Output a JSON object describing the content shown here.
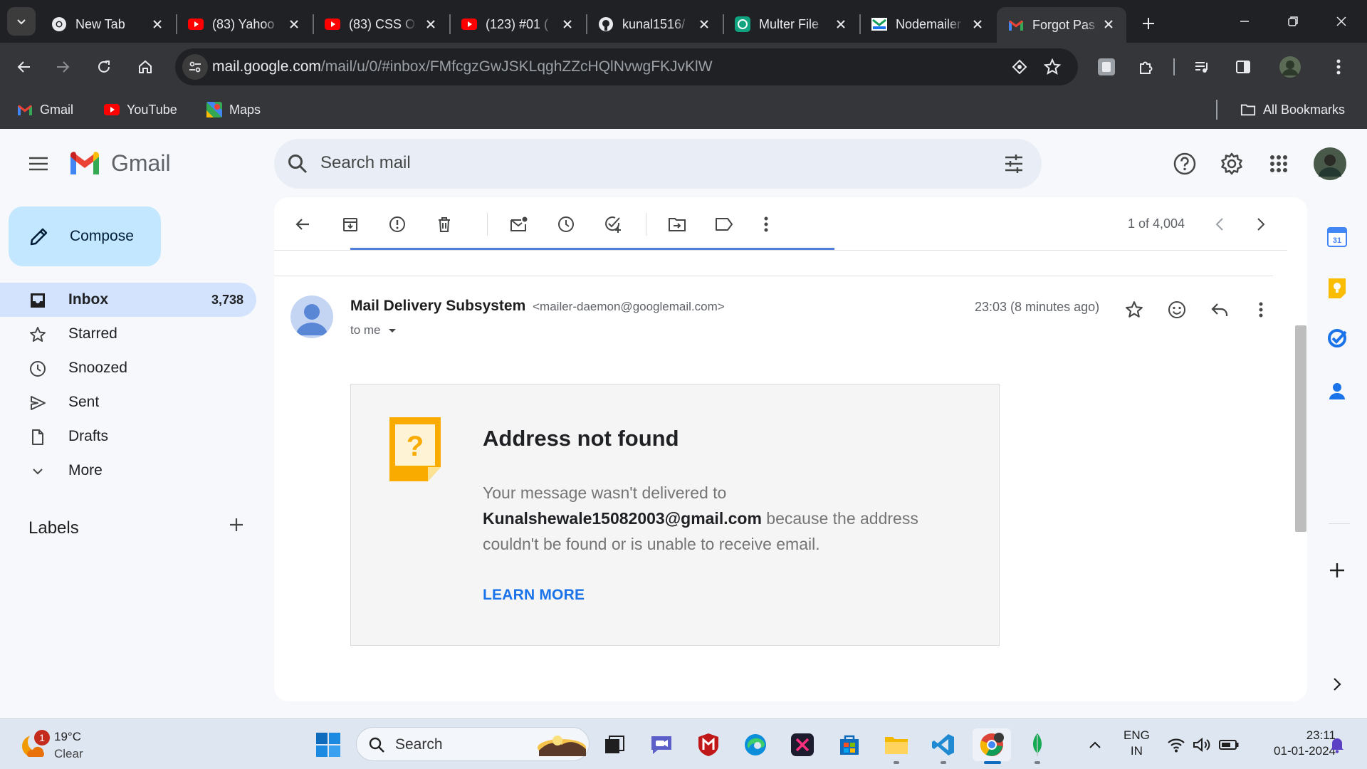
{
  "browser": {
    "tabs": [
      {
        "title": "New Tab",
        "icon": "chrome-icon",
        "active": false
      },
      {
        "title": "(83) Yahoo",
        "icon": "youtube-icon",
        "active": false
      },
      {
        "title": "(83) CSS O",
        "icon": "youtube-icon",
        "active": false
      },
      {
        "title": "(123) #01 (",
        "icon": "youtube-icon",
        "active": false
      },
      {
        "title": "kunal1516/",
        "icon": "github-icon",
        "active": false
      },
      {
        "title": "Multer File",
        "icon": "chatgpt-icon",
        "active": false
      },
      {
        "title": "Nodemailer",
        "icon": "nodemailer-icon",
        "active": false
      },
      {
        "title": "Forgot Pas",
        "icon": "gmail-icon",
        "active": true
      }
    ],
    "url_host": "mail.google.com",
    "url_path": "/mail/u/0/#inbox/FMfcgzGwJSKLqghZZcHQlNvwgFKJvKlW",
    "bookmarks": [
      {
        "label": "Gmail",
        "icon": "gmail-icon"
      },
      {
        "label": "YouTube",
        "icon": "youtube-icon"
      },
      {
        "label": "Maps",
        "icon": "maps-icon"
      }
    ],
    "all_bookmarks": "All Bookmarks"
  },
  "gmail": {
    "brand": "Gmail",
    "search_placeholder": "Search mail",
    "compose_label": "Compose",
    "nav": [
      {
        "label": "Inbox",
        "count": "3,738",
        "icon": "inbox-icon",
        "active": true
      },
      {
        "label": "Starred",
        "count": "",
        "icon": "star-icon",
        "active": false
      },
      {
        "label": "Snoozed",
        "count": "",
        "icon": "clock-icon",
        "active": false
      },
      {
        "label": "Sent",
        "count": "",
        "icon": "send-icon",
        "active": false
      },
      {
        "label": "Drafts",
        "count": "",
        "icon": "draft-icon",
        "active": false
      },
      {
        "label": "More",
        "count": "",
        "icon": "chevron-down-icon",
        "active": false
      }
    ],
    "labels_heading": "Labels",
    "pager": "1 of 4,004",
    "message": {
      "sender_name": "Mail Delivery Subsystem",
      "sender_email": "<mailer-daemon@googlemail.com>",
      "to": "to me",
      "time": "23:03 (8 minutes ago)",
      "notice_title": "Address not found",
      "notice_body_before": "Your message wasn't delivered to",
      "notice_address": "Kunalshewale15082003@gmail.com",
      "notice_body_after": "because the address couldn't be found or is unable to receive email.",
      "learn_more": "LEARN MORE"
    }
  },
  "taskbar": {
    "weather_temp": "19°C",
    "weather_cond": "Clear",
    "weather_badge": "1",
    "search_label": "Search",
    "lang_line1": "ENG",
    "lang_line2": "IN",
    "time": "23:11",
    "date": "01-01-2024"
  },
  "colors": {
    "chrome_bg": "#202124",
    "chrome_toolbar": "#35363a",
    "gmail_bg": "#f6f8fc",
    "compose_bg": "#c2e7ff",
    "nav_active": "#d3e3fd",
    "link_blue": "#1a73e8",
    "notice_orange": "#f9ab00"
  }
}
